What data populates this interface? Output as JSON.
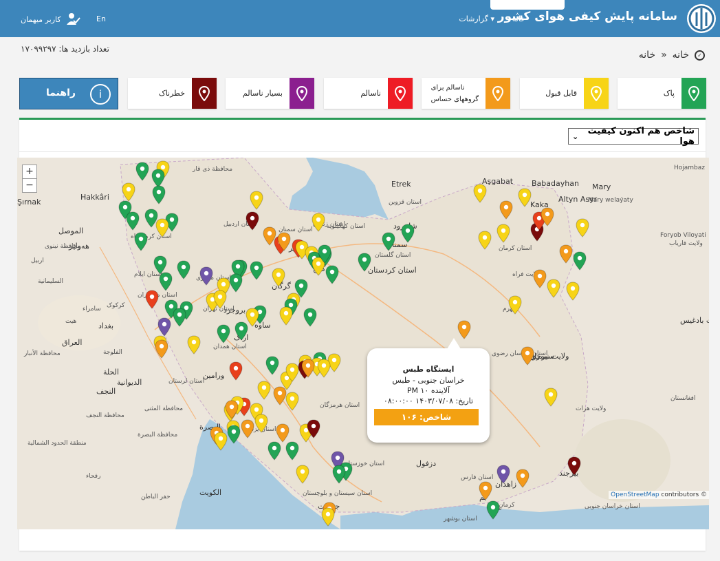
{
  "header": {
    "brand": "سامانه پایش کیفی هوای کشور",
    "nav_home": "خانه",
    "nav_reports": "گزارشات",
    "lang": "En",
    "user": "کاربر میهمان"
  },
  "visits": "تعداد بازدید ها: ۱۷۰۹۹۲۹۷",
  "breadcrumb": {
    "home": "خانه",
    "current": "خانه"
  },
  "legend": [
    {
      "label": "پاک",
      "color": "#23a455"
    },
    {
      "label": "قابل قبول",
      "color": "#f7d417"
    },
    {
      "label_line1": "ناسالم برای",
      "label_line2": "گروههای حساس",
      "color": "#f39a1b"
    },
    {
      "label": "ناسالم",
      "color": "#ee1c25"
    },
    {
      "label": "بسیار ناسالم",
      "color": "#8b1f8f"
    },
    {
      "label": "خطرناک",
      "color": "#7a0b0b"
    }
  ],
  "guide_label": "راهنما",
  "index_select": "شاخص هم اکنون کیفیت هوا",
  "map": {
    "attribution_link": "OpenStreetMap",
    "attribution_rest": " contributors ©",
    "zoom_in": "+",
    "zoom_out": "−",
    "labels": [
      "Aşgabat",
      "Etrek",
      "Babadayhan",
      "Mary",
      "Hojambaz",
      "Şırnak",
      "Hakkâri",
      "Altyn Asyr",
      "Kaka",
      "Mary welaýaty",
      "Foryob Viloyati",
      "ولایت فاریاب",
      "الموصل",
      "هەولێر",
      "محافظة نینوی",
      "اربیل",
      "السلیمانیة",
      "بغداد",
      "کرکوک",
      "الدیوانیة",
      "النجف",
      "الحلة",
      "البصرة",
      "الکویت",
      "الفلوجة",
      "هیت",
      "العراق",
      "سامراء",
      "محافظة الأنبار",
      "محافظة النجف",
      "محافظة البصرة",
      "منطقة الحدود الشمالیة",
      "حفر الباطن",
      "رفحاء",
      "محافظة المثنی",
      "محافظة ذی قار",
      "استان اردبیل",
      "استان زنجان",
      "استان قزوین",
      "استان گلستان",
      "استان سمنان",
      "استان تهران",
      "استان مرکزی",
      "استان همدان",
      "استان لرستان",
      "استان خوزستان",
      "استان فارس",
      "استان کرمان",
      "استان خراسان رضوی",
      "استان خراسان جنوبی",
      "استان سیستان و بلوچستان",
      "استان بوشهر",
      "استان هرمزگان",
      "استان اصفهان",
      "استان یزد",
      "استان کهگیلویه",
      "استان مازندران",
      "استان ایلام",
      "استان کرمانشاه",
      "استان کردستان",
      "سمنان",
      "شاهرود",
      "گرگان",
      "ساوه",
      "اراک",
      "بروجرد",
      "ملایر",
      "کرج",
      "ورامین",
      "دزفول",
      "سیرجان",
      "بیرجند",
      "زاهدان",
      "بم",
      "جیرفت",
      "جهرم",
      "ولایت هرات",
      "ولایت فراه",
      "ولایت بادغیس",
      "افغانستان",
      "ولایت نیمروز",
      "بیرجند",
      "شهر",
      "کرمان",
      "لار"
    ],
    "markers": [
      {
        "c": "green"
      },
      {
        "c": "yellow"
      },
      {
        "c": "green"
      },
      {
        "c": "yellow"
      },
      {
        "c": "green"
      },
      {
        "c": "green"
      },
      {
        "c": "green"
      },
      {
        "c": "green"
      },
      {
        "c": "yellow"
      },
      {
        "c": "green"
      },
      {
        "c": "green"
      },
      {
        "c": "yellow"
      },
      {
        "c": "darkred"
      },
      {
        "c": "yellow"
      },
      {
        "c": "orange"
      },
      {
        "c": "red"
      },
      {
        "c": "orange"
      },
      {
        "c": "red"
      },
      {
        "c": "yellow"
      },
      {
        "c": "yellow"
      },
      {
        "c": "green"
      },
      {
        "c": "green"
      },
      {
        "c": "yellow"
      },
      {
        "c": "green"
      },
      {
        "c": "green"
      },
      {
        "c": "green"
      },
      {
        "c": "green"
      },
      {
        "c": "green"
      },
      {
        "c": "purple"
      },
      {
        "c": "green"
      },
      {
        "c": "green"
      },
      {
        "c": "green"
      },
      {
        "c": "yellow"
      },
      {
        "c": "green"
      },
      {
        "c": "green"
      },
      {
        "c": "green"
      },
      {
        "c": "yellow"
      },
      {
        "c": "green"
      },
      {
        "c": "red"
      },
      {
        "c": "green"
      },
      {
        "c": "purple"
      },
      {
        "c": "green"
      },
      {
        "c": "green"
      },
      {
        "c": "yellow"
      },
      {
        "c": "yellow"
      },
      {
        "c": "green"
      },
      {
        "c": "yellow"
      },
      {
        "c": "green"
      },
      {
        "c": "green"
      },
      {
        "c": "yellow"
      },
      {
        "c": "green"
      },
      {
        "c": "yellow"
      },
      {
        "c": "green"
      },
      {
        "c": "green"
      },
      {
        "c": "yellow"
      },
      {
        "c": "yellow"
      },
      {
        "c": "orange"
      },
      {
        "c": "red"
      },
      {
        "c": "green"
      },
      {
        "c": "green"
      },
      {
        "c": "yellow"
      },
      {
        "c": "yellow"
      },
      {
        "c": "yellow"
      },
      {
        "c": "darkred"
      },
      {
        "c": "yellow"
      },
      {
        "c": "yellow"
      },
      {
        "c": "orange"
      },
      {
        "c": "orange"
      },
      {
        "c": "yellow"
      },
      {
        "c": "yellow"
      },
      {
        "c": "yellow"
      },
      {
        "c": "red"
      },
      {
        "c": "orange"
      },
      {
        "c": "yellow"
      },
      {
        "c": "yellow"
      },
      {
        "c": "orange"
      },
      {
        "c": "yellow"
      },
      {
        "c": "yellow"
      },
      {
        "c": "yellow"
      },
      {
        "c": "green"
      },
      {
        "c": "yellow"
      },
      {
        "c": "orange"
      },
      {
        "c": "orange"
      },
      {
        "c": "yellow"
      },
      {
        "c": "green"
      },
      {
        "c": "green"
      },
      {
        "c": "darkred"
      },
      {
        "c": "purple"
      },
      {
        "c": "yellow"
      },
      {
        "c": "green"
      },
      {
        "c": "green"
      },
      {
        "c": "yellow"
      },
      {
        "c": "yellow"
      },
      {
        "c": "orange"
      },
      {
        "c": "yellow"
      },
      {
        "c": "darkred"
      },
      {
        "c": "red"
      },
      {
        "c": "yellow"
      },
      {
        "c": "yellow"
      },
      {
        "c": "orange"
      },
      {
        "c": "green"
      },
      {
        "c": "orange"
      },
      {
        "c": "yellow"
      },
      {
        "c": "yellow"
      },
      {
        "c": "yellow"
      },
      {
        "c": "orange"
      },
      {
        "c": "orange"
      },
      {
        "c": "yellow"
      },
      {
        "c": "darkred"
      },
      {
        "c": "purple"
      },
      {
        "c": "orange"
      },
      {
        "c": "orange"
      },
      {
        "c": "green"
      },
      {
        "c": "orange"
      },
      {
        "c": "yellow"
      },
      {
        "c": "orange"
      }
    ]
  },
  "popup": {
    "station": "ایستگاه طبس",
    "place": "خراسان جنوبی - طبس",
    "pollutant": "آلاینده PM ۱۰",
    "date": "تاریخ: ۱۴۰۳/۰۷/۰۸ ۰۸:۰۰:۰۰",
    "index": "شاخص: ۱۰۶"
  },
  "colors": {
    "green": "#23a455",
    "yellow": "#f7d417",
    "orange": "#f39a1b",
    "red": "#e8401c",
    "purple": "#6f55a8",
    "darkred": "#7a0b0b",
    "header": "#3d86bb",
    "sea": "#a9cbe0"
  }
}
